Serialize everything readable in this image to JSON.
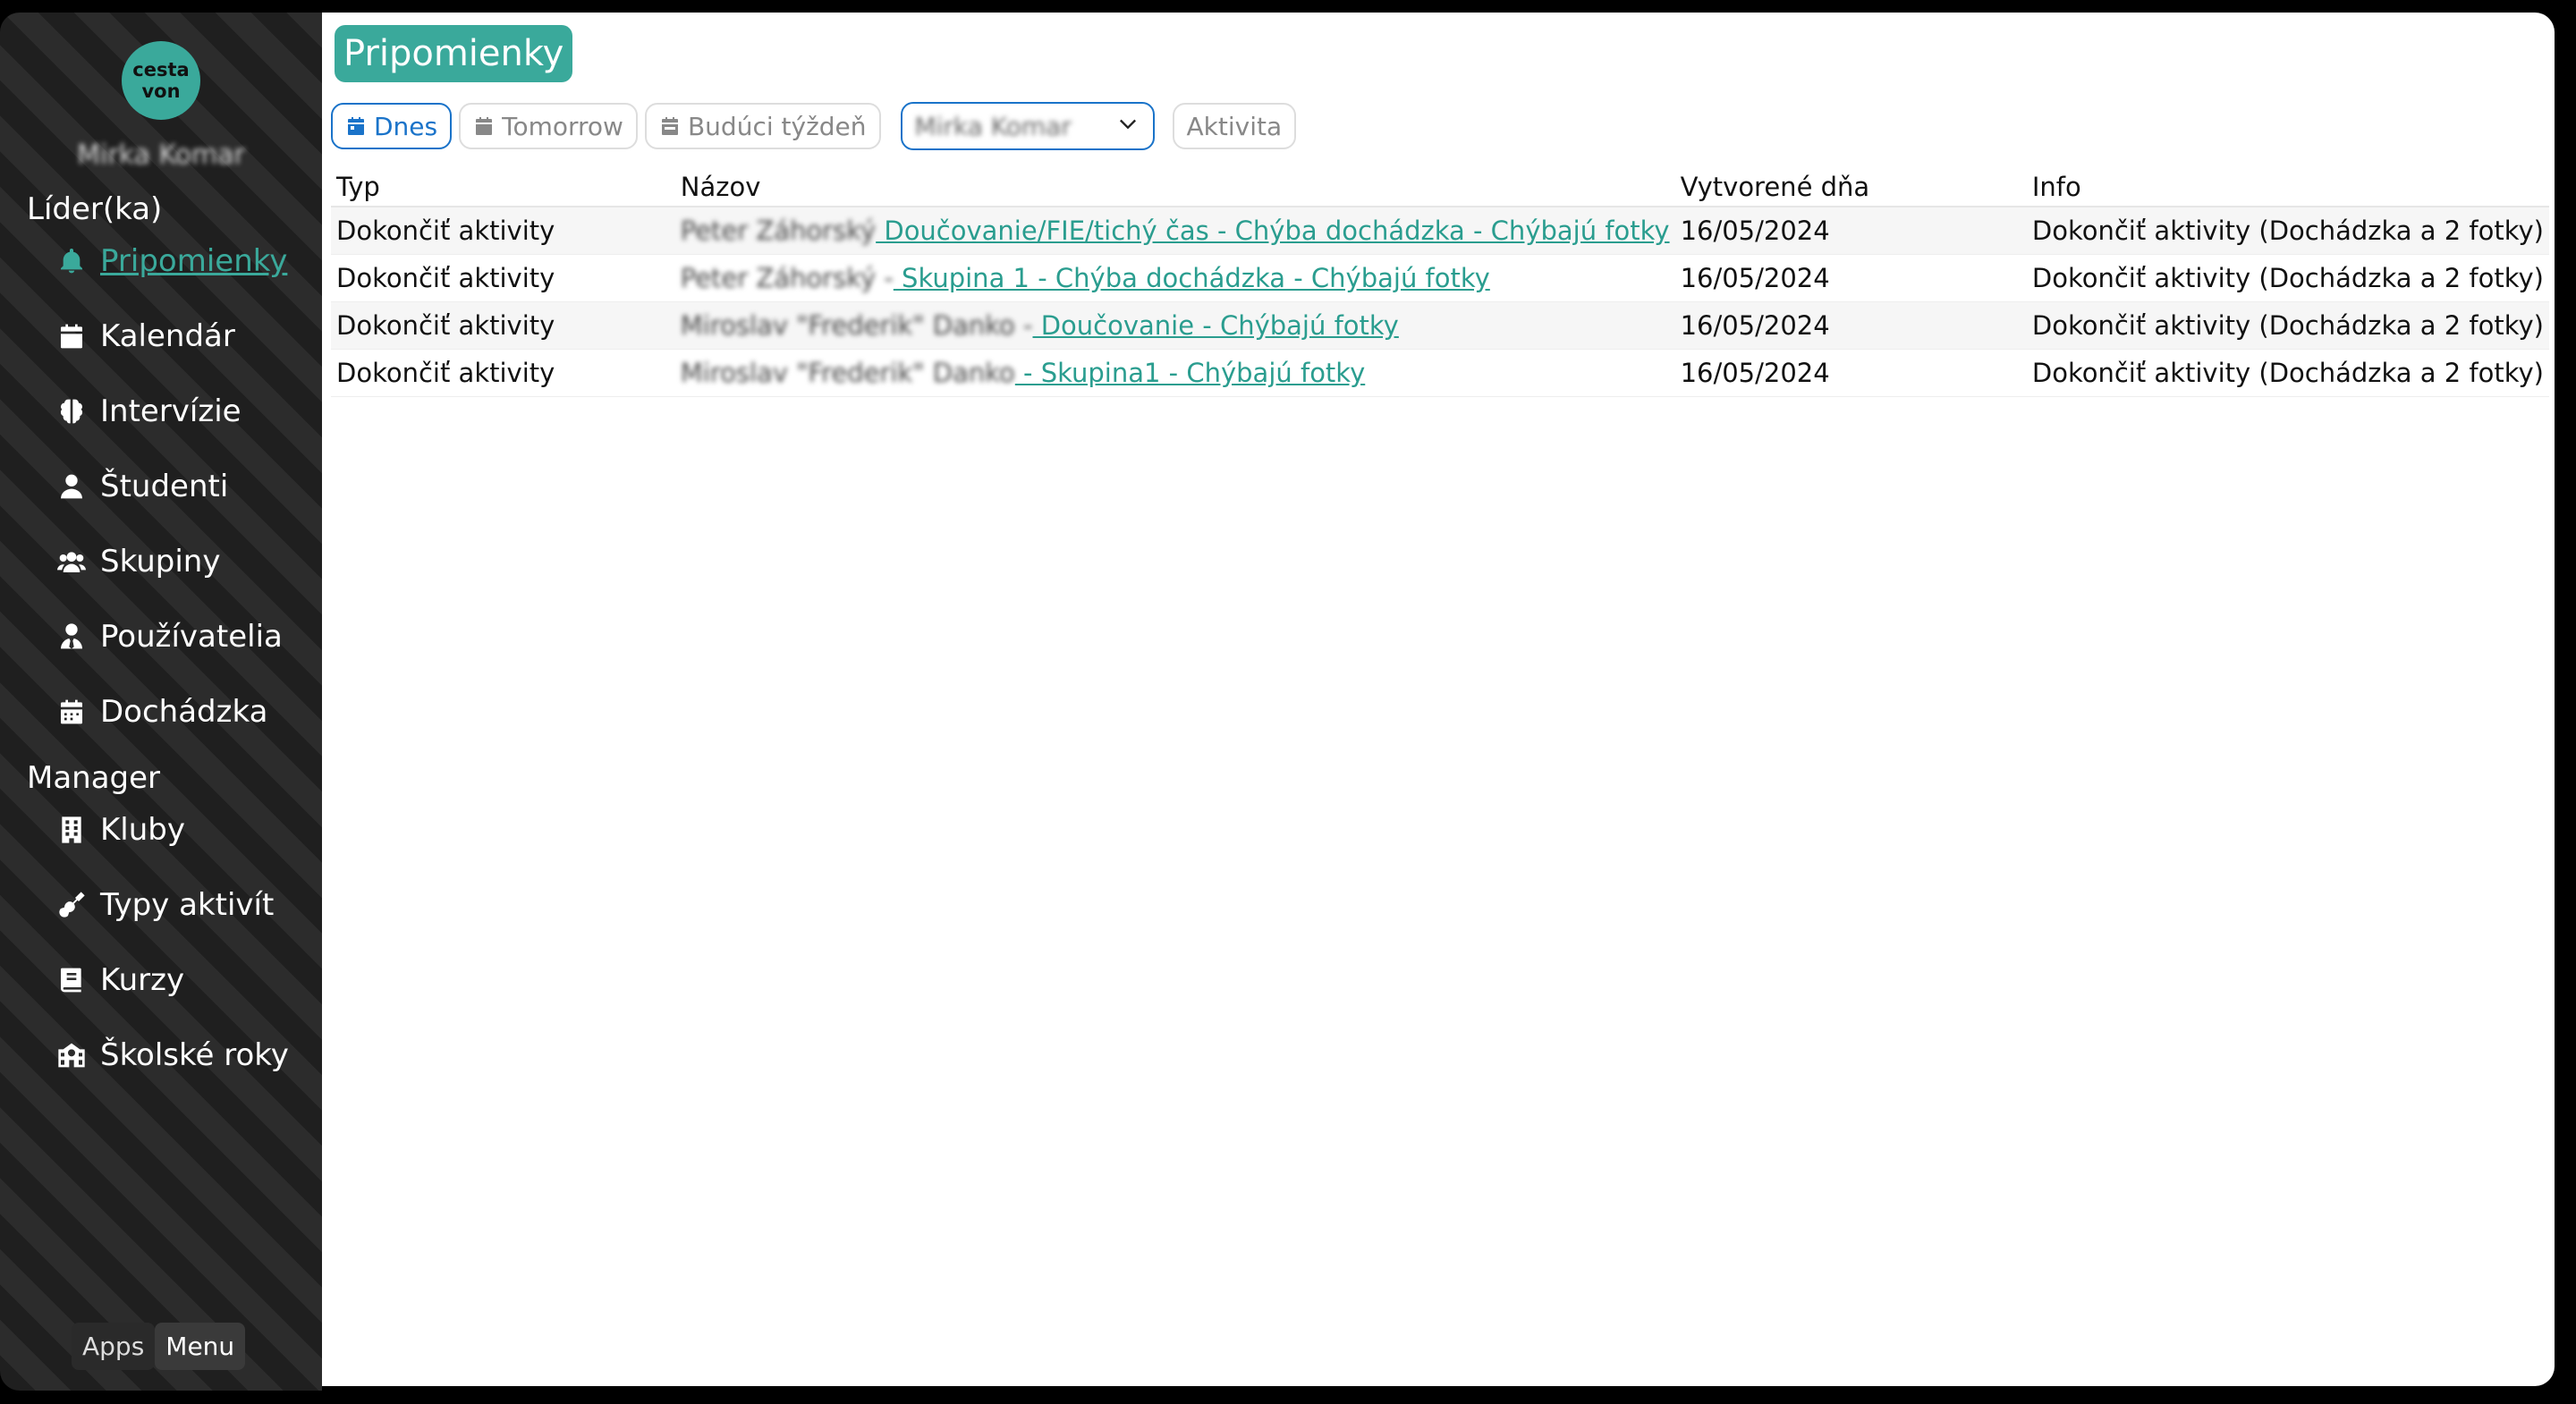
{
  "sidebar": {
    "logo": {
      "line1": "cesta",
      "line2": "von",
      "color": "#3aa99b"
    },
    "user_name": "Mirka Komar",
    "sections": [
      {
        "title": "Líder(ka)"
      },
      {
        "title": "Manager"
      }
    ],
    "items": [
      {
        "label": "Pripomienky",
        "icon": "bell-icon",
        "active": true
      },
      {
        "label": "Kalendár",
        "icon": "calendar-icon"
      },
      {
        "label": "Intervízie",
        "icon": "brain-icon"
      },
      {
        "label": "Študenti",
        "icon": "user-icon"
      },
      {
        "label": "Skupiny",
        "icon": "users-icon"
      },
      {
        "label": "Používatelia",
        "icon": "user-tie-icon"
      },
      {
        "label": "Dochádzka",
        "icon": "calendar-days-icon"
      },
      {
        "label": "Kluby",
        "icon": "building-icon"
      },
      {
        "label": "Typy aktivít",
        "icon": "guitar-icon"
      },
      {
        "label": "Kurzy",
        "icon": "book-icon"
      },
      {
        "label": "Školské roky",
        "icon": "school-icon"
      }
    ],
    "bottom_tabs": [
      "Apps",
      "Menu"
    ]
  },
  "main": {
    "title": "Pripomienky",
    "filters": {
      "today": "Dnes",
      "tomorrow": "Tomorrow",
      "next_week": "Budúci týždeň",
      "select_value": "Mirka Komar",
      "activity": "Aktivita"
    },
    "table": {
      "headers": [
        "Typ",
        "Názov",
        "Vytvorené dňa",
        "Info"
      ],
      "rows": [
        {
          "typ": "Dokončiť aktivity",
          "name": "Peter Záhorský",
          "link": " Doučovanie/FIE/tichý čas - Chýba dochádzka - Chýbajú fotky",
          "date": "16/05/2024",
          "info": "Dokončiť aktivity (Dochádzka a 2 fotky)"
        },
        {
          "typ": "Dokončiť aktivity",
          "name": "Peter Záhorský -",
          "link": " Skupina 1 - Chýba dochádzka - Chýbajú fotky",
          "date": "16/05/2024",
          "info": "Dokončiť aktivity (Dochádzka a 2 fotky)"
        },
        {
          "typ": "Dokončiť aktivity",
          "name": "Miroslav \"Frederik\" Danko -",
          "link": " Doučovanie - Chýbajú fotky",
          "date": "16/05/2024",
          "info": "Dokončiť aktivity (Dochádzka a 2 fotky)"
        },
        {
          "typ": "Dokončiť aktivity",
          "name": "Miroslav \"Frederik\" Danko",
          "link": " - Skupina1 - Chýbajú fotky",
          "date": "16/05/2024",
          "info": "Dokončiť aktivity (Dochádzka a 2 fotky)"
        }
      ]
    }
  },
  "colors": {
    "accent": "#3aa99b",
    "primary_blue": "#1a73c9",
    "link": "#2a9d8f"
  }
}
